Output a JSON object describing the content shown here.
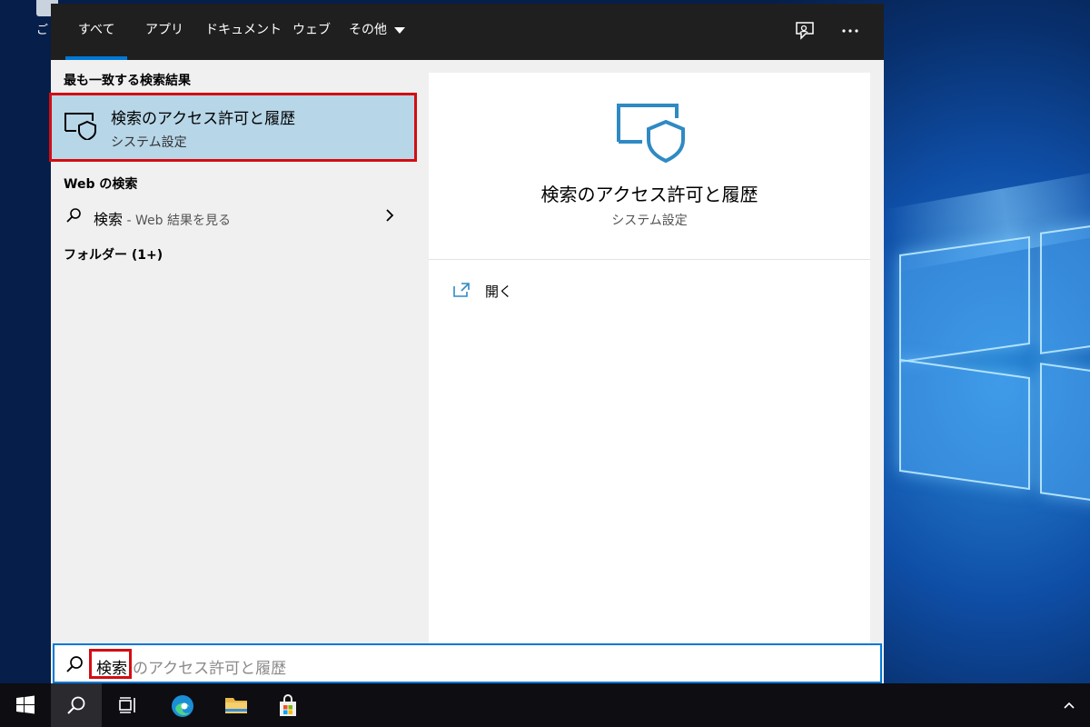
{
  "desktop": {
    "icon_label": "ご"
  },
  "tabs": [
    {
      "label": "すべて"
    },
    {
      "label": "アプリ"
    },
    {
      "label": "ドキュメント"
    },
    {
      "label": "ウェブ"
    },
    {
      "label": "その他"
    }
  ],
  "left": {
    "best_match_heading": "最も一致する検索結果",
    "best_match": {
      "title": "検索のアクセス許可と履歴",
      "subtitle": "システム設定"
    },
    "web_heading": "Web の検索",
    "web_result": {
      "query": "検索",
      "suffix": " - Web 結果を見る"
    },
    "folders_heading": "フォルダー (1+)"
  },
  "right": {
    "title": "検索のアクセス許可と履歴",
    "subtitle": "システム設定",
    "open_label": "開く"
  },
  "searchbox": {
    "typed": "検索",
    "suggestion": "のアクセス許可と履歴"
  },
  "colors": {
    "accent": "#0078d7",
    "highlight": "#b7d6e8",
    "annotation": "#d40d12",
    "icon_blue": "#2f8ac4"
  }
}
